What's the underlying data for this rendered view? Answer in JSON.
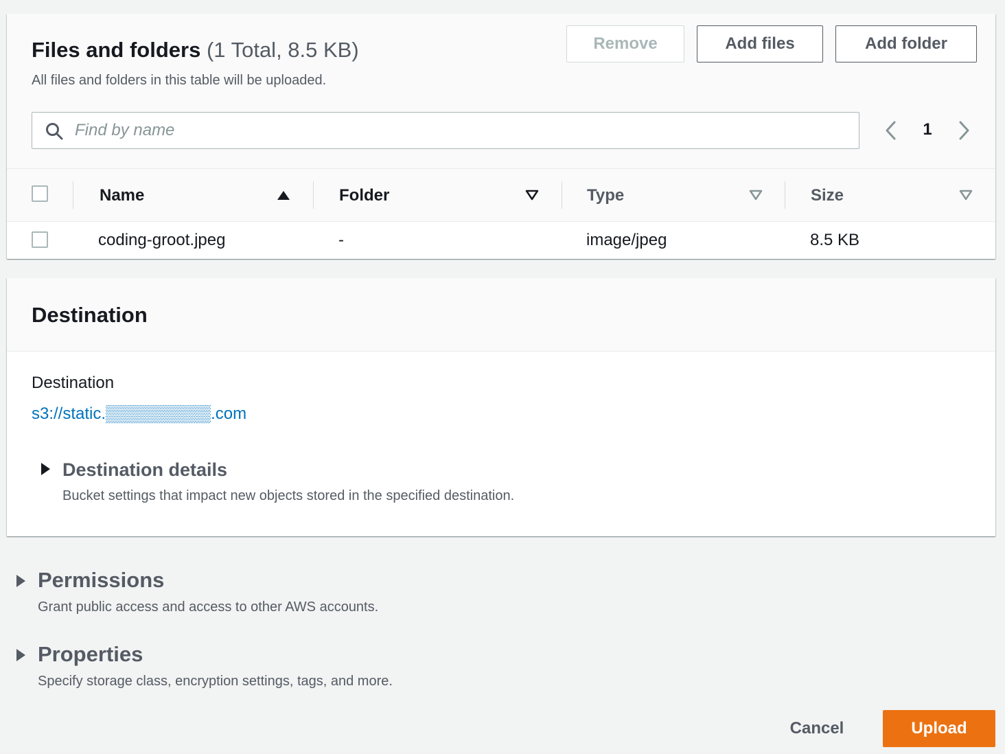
{
  "files": {
    "title": "Files and folders",
    "count": "(1 Total, 8.5 KB)",
    "description": "All files and folders in this table will be uploaded.",
    "remove_label": "Remove",
    "add_files_label": "Add files",
    "add_folder_label": "Add folder",
    "search_placeholder": "Find by name",
    "search_value": "",
    "current_page": "1",
    "columns": [
      {
        "label": "Name",
        "sort": "ascending"
      },
      {
        "label": "Folder",
        "sort": "none"
      },
      {
        "label": "Type",
        "sort": "none"
      },
      {
        "label": "Size",
        "sort": "none"
      }
    ],
    "rows": [
      {
        "name": "coding-groot.jpeg",
        "folder": "-",
        "type": "image/jpeg",
        "size": "8.5 KB",
        "checked": false
      }
    ]
  },
  "destination": {
    "title": "Destination",
    "label": "Destination",
    "url": "s3://static.▒▒▒▒▒▒▒▒▒.com",
    "details_title": "Destination details",
    "details_desc": "Bucket settings that impact new objects stored in the specified destination."
  },
  "permissions": {
    "title": "Permissions",
    "desc": "Grant public access and access to other AWS accounts."
  },
  "properties": {
    "title": "Properties",
    "desc": "Specify storage class, encryption settings, tags, and more."
  },
  "footer": {
    "cancel_label": "Cancel",
    "upload_label": "Upload"
  },
  "colors": {
    "primary_button": "#ec7211",
    "link": "#0073bb",
    "text_secondary": "#545b64",
    "page_background": "#f2f3f3"
  },
  "icons": {
    "search": "search-icon",
    "prev": "chevron-left-icon",
    "next": "chevron-right-icon",
    "sort_asc": "sort-ascending-icon",
    "sort_none": "sort-descending-outline-icon",
    "expand": "caret-right-icon"
  }
}
